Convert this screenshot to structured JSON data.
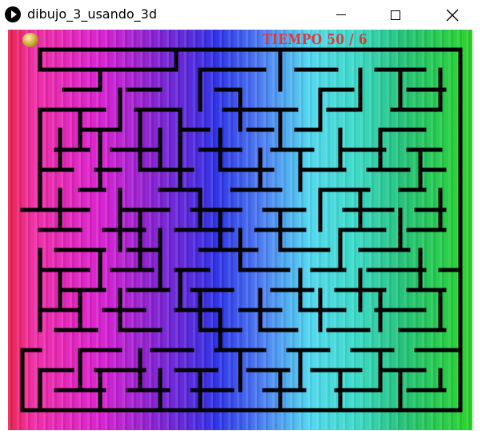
{
  "window": {
    "title": "dibujo_3_usando_3d"
  },
  "hud": {
    "text": "TIEMPO 50 /  6"
  },
  "colors": {
    "maze_wall": "#000000",
    "hud_text": "#e03838",
    "ball": "#c9a230"
  },
  "icons": {
    "app": "play-icon",
    "minimize": "minimize-icon",
    "maximize": "maximize-icon",
    "close": "close-icon"
  }
}
